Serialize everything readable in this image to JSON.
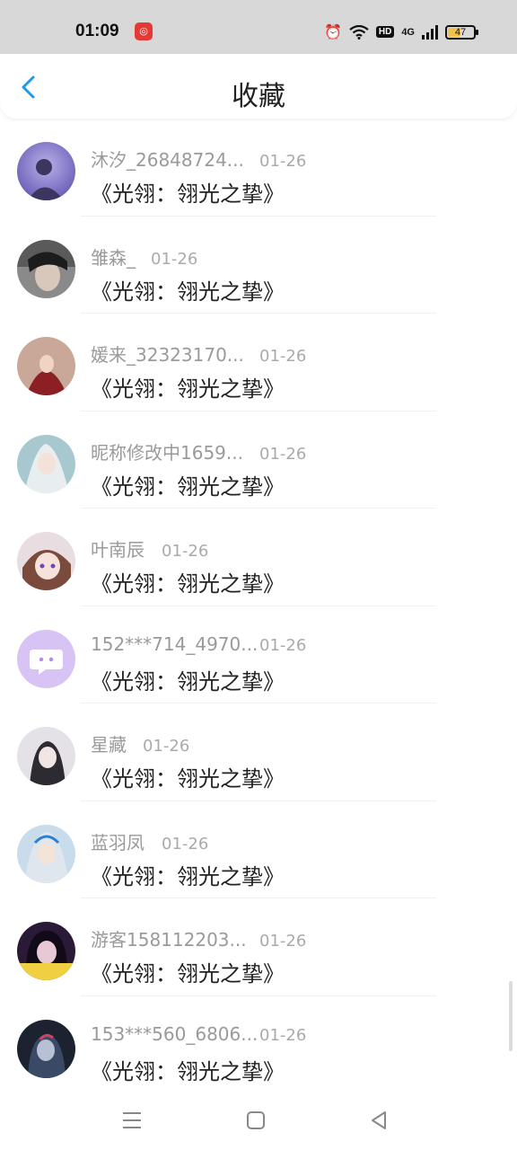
{
  "status_bar": {
    "time": "01:09",
    "battery": "47",
    "network": "4G",
    "hd": "HD"
  },
  "header": {
    "title": "收藏"
  },
  "items": [
    {
      "name": "沐汐_26848724...",
      "date": "01-26",
      "content": "《光翎：翎光之挚》"
    },
    {
      "name": "雏森_",
      "date": "01-26",
      "content": "《光翎：翎光之挚》"
    },
    {
      "name": "媛来_32323170...",
      "date": "01-26",
      "content": "《光翎：翎光之挚》"
    },
    {
      "name": "昵称修改中1659...",
      "date": "01-26",
      "content": "《光翎：翎光之挚》"
    },
    {
      "name": "叶南辰",
      "date": "01-26",
      "content": "《光翎：翎光之挚》"
    },
    {
      "name": "152***714_4970...",
      "date": "01-26",
      "content": "《光翎：翎光之挚》"
    },
    {
      "name": "星藏",
      "date": "01-26",
      "content": "《光翎：翎光之挚》"
    },
    {
      "name": "蓝羽凤",
      "date": "01-26",
      "content": "《光翎：翎光之挚》"
    },
    {
      "name": "游客158112203...",
      "date": "01-26",
      "content": "《光翎：翎光之挚》"
    },
    {
      "name": "153***560_6806...",
      "date": "01-26",
      "content": "《光翎：翎光之挚》"
    }
  ],
  "colors": {
    "accent": "#1e9be8",
    "header_bg": "#ffffff",
    "status_bg": "#d8d8d8"
  }
}
